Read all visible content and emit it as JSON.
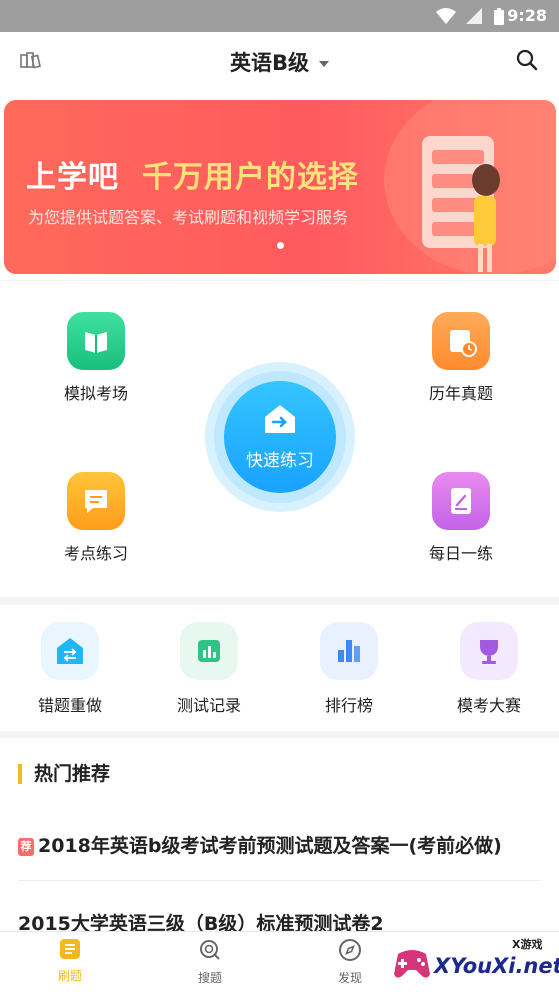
{
  "status_bar": {
    "time": "9:28",
    "icons": [
      "wifi-icon",
      "signal-icon",
      "battery-icon"
    ]
  },
  "header": {
    "title": "英语B级",
    "left_icon": "books-icon",
    "right_icon": "search-icon"
  },
  "banner": {
    "headline_part1": "上学吧",
    "headline_part2": "千万用户的选择",
    "subtitle": "为您提供试题答案、考试刷题和视频学习服务"
  },
  "features": {
    "mock_exam": "模拟考场",
    "past_papers": "历年真题",
    "quick_practice": "快速练习",
    "topic_practice": "考点练习",
    "daily_practice": "每日一练"
  },
  "tools": [
    {
      "label": "错题重做",
      "icon": "redo-icon",
      "color": "#22b6f5"
    },
    {
      "label": "测试记录",
      "icon": "chart-icon",
      "color": "#2fc486"
    },
    {
      "label": "排行榜",
      "icon": "rank-bars-icon",
      "color": "#3d8bf2"
    },
    {
      "label": "模考大赛",
      "icon": "trophy-icon",
      "color": "#a25be0"
    }
  ],
  "recommend": {
    "title": "热门推荐",
    "tag": "荐",
    "articles": [
      "2018年英语b级考试考前预测试题及答案一(考前必做)",
      "2015大学英语三级（B级）标准预测试卷2"
    ]
  },
  "tabbar": [
    {
      "label": "刷题",
      "icon": "list-icon",
      "active": true
    },
    {
      "label": "搜题",
      "icon": "search-icon",
      "active": false
    },
    {
      "label": "发现",
      "icon": "compass-icon",
      "active": false
    }
  ],
  "watermark": {
    "site": "XYouXi.net",
    "brand": "X游戏"
  }
}
